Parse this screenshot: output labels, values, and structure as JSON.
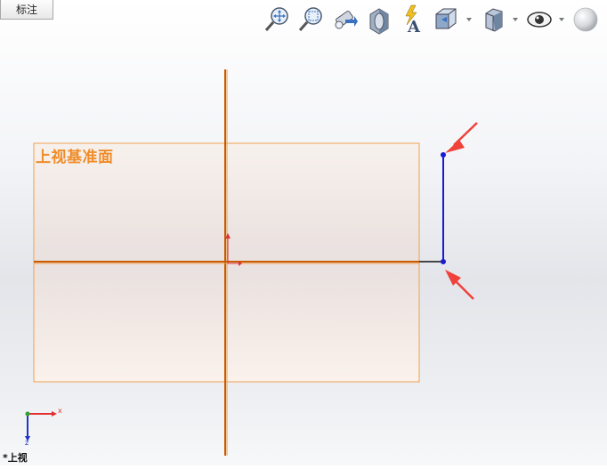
{
  "tab": {
    "label": "标注"
  },
  "toolbar": {
    "buttons": [
      {
        "name": "zoom-to-fit-icon"
      },
      {
        "name": "zoom-to-area-icon"
      },
      {
        "name": "previous-view-icon"
      },
      {
        "name": "section-view-icon"
      },
      {
        "name": "dynamic-annotation-view-icon"
      },
      {
        "name": "view-orientation-icon",
        "dropdown": true
      },
      {
        "name": "display-style-icon",
        "dropdown": true
      },
      {
        "name": "hide-show-items-icon",
        "dropdown": true
      },
      {
        "name": "edit-appearance-icon"
      }
    ]
  },
  "viewport": {
    "plane_label": "上视基准面",
    "view_name": "*上视",
    "triad": {
      "x_label": "x",
      "z_label": "z"
    }
  },
  "colors": {
    "plane_border": "#f0a050",
    "plane_fill": "#f7e7dc",
    "plane_label": "#f08c28",
    "axis_line": "#c55a00",
    "sketch_line": "#1a1ad4",
    "arrow": "#f0413a",
    "triad_x": "#e03030",
    "triad_y": "#30a030",
    "triad_z": "#2233cc"
  }
}
